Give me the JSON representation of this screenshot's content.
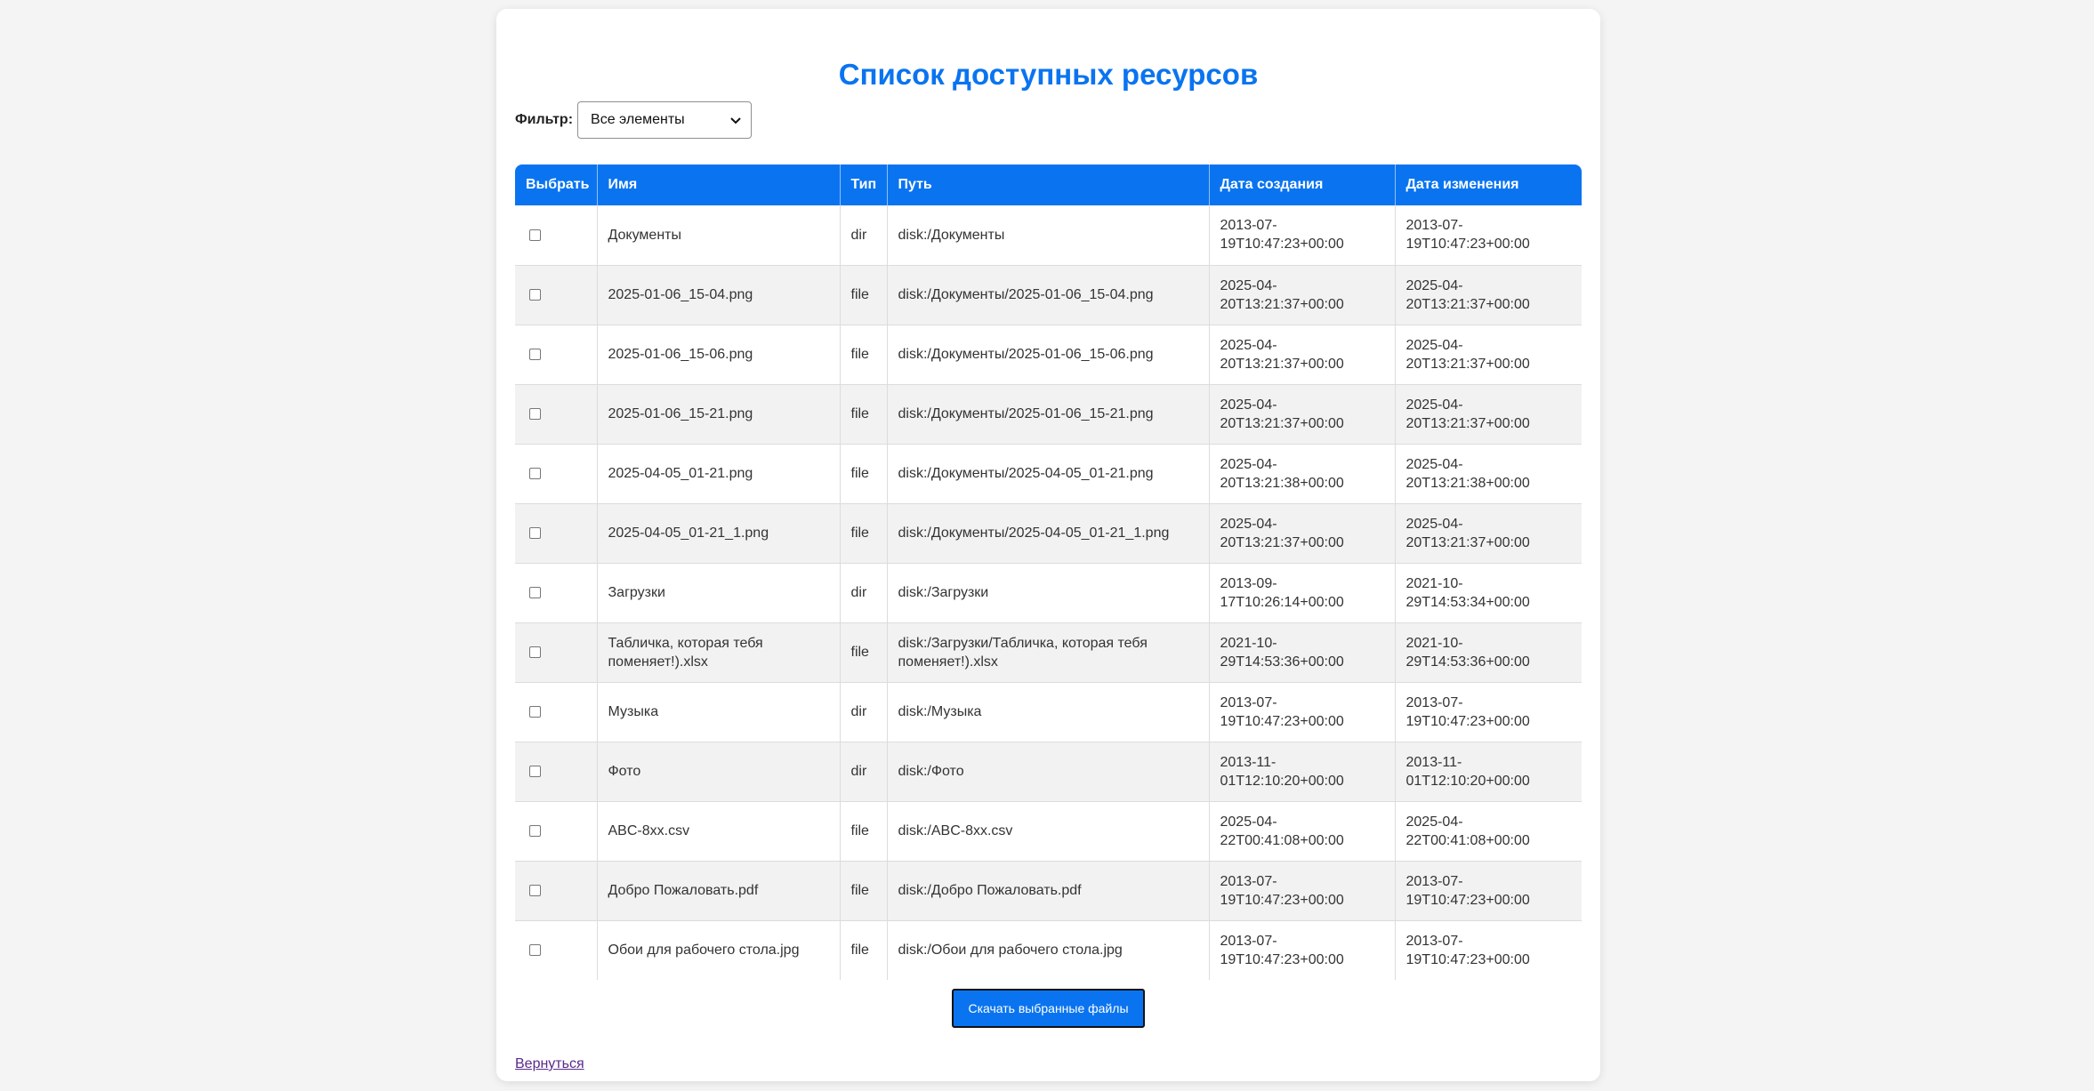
{
  "page": {
    "title": "Список доступных ресурсов"
  },
  "filter": {
    "label": "Фильтр:",
    "selected": "Все элементы"
  },
  "table": {
    "headers": [
      "Выбрать",
      "Имя",
      "Тип",
      "Путь",
      "Дата создания",
      "Дата изменения"
    ],
    "rows": [
      {
        "checked": false,
        "name": "Документы",
        "type": "dir",
        "path": "disk:/Документы",
        "created_a": "2013-07-",
        "created_b": "19T10:47:23+00:00",
        "modified_a": "2013-07-",
        "modified_b": "19T10:47:23+00:00"
      },
      {
        "checked": false,
        "name": "2025-01-06_15-04.png",
        "type": "file",
        "path": "disk:/Документы/2025-01-06_15-04.png",
        "created_a": "2025-04-",
        "created_b": "20T13:21:37+00:00",
        "modified_a": "2025-04-",
        "modified_b": "20T13:21:37+00:00"
      },
      {
        "checked": false,
        "name": "2025-01-06_15-06.png",
        "type": "file",
        "path": "disk:/Документы/2025-01-06_15-06.png",
        "created_a": "2025-04-",
        "created_b": "20T13:21:37+00:00",
        "modified_a": "2025-04-",
        "modified_b": "20T13:21:37+00:00"
      },
      {
        "checked": false,
        "name": "2025-01-06_15-21.png",
        "type": "file",
        "path": "disk:/Документы/2025-01-06_15-21.png",
        "created_a": "2025-04-",
        "created_b": "20T13:21:37+00:00",
        "modified_a": "2025-04-",
        "modified_b": "20T13:21:37+00:00"
      },
      {
        "checked": false,
        "name": "2025-04-05_01-21.png",
        "type": "file",
        "path": "disk:/Документы/2025-04-05_01-21.png",
        "created_a": "2025-04-",
        "created_b": "20T13:21:38+00:00",
        "modified_a": "2025-04-",
        "modified_b": "20T13:21:38+00:00"
      },
      {
        "checked": false,
        "name": "2025-04-05_01-21_1.png",
        "type": "file",
        "path": "disk:/Документы/2025-04-05_01-21_1.png",
        "created_a": "2025-04-",
        "created_b": "20T13:21:37+00:00",
        "modified_a": "2025-04-",
        "modified_b": "20T13:21:37+00:00"
      },
      {
        "checked": false,
        "name": "Загрузки",
        "type": "dir",
        "path": "disk:/Загрузки",
        "created_a": "2013-09-",
        "created_b": "17T10:26:14+00:00",
        "modified_a": "2021-10-",
        "modified_b": "29T14:53:34+00:00"
      },
      {
        "checked": false,
        "name": "Табличка, которая тебя поменяет!).xlsx",
        "type": "file",
        "path": "disk:/Загрузки/Табличка, которая тебя поменяет!).xlsx",
        "created_a": "2021-10-",
        "created_b": "29T14:53:36+00:00",
        "modified_a": "2021-10-",
        "modified_b": "29T14:53:36+00:00"
      },
      {
        "checked": false,
        "name": "Музыка",
        "type": "dir",
        "path": "disk:/Музыка",
        "created_a": "2013-07-",
        "created_b": "19T10:47:23+00:00",
        "modified_a": "2013-07-",
        "modified_b": "19T10:47:23+00:00"
      },
      {
        "checked": false,
        "name": "Фото",
        "type": "dir",
        "path": "disk:/Фото",
        "created_a": "2013-11-",
        "created_b": "01T12:10:20+00:00",
        "modified_a": "2013-11-",
        "modified_b": "01T12:10:20+00:00"
      },
      {
        "checked": false,
        "name": "ABC-8xx.csv",
        "type": "file",
        "path": "disk:/ABC-8xx.csv",
        "created_a": "2025-04-",
        "created_b": "22T00:41:08+00:00",
        "modified_a": "2025-04-",
        "modified_b": "22T00:41:08+00:00"
      },
      {
        "checked": false,
        "name": "Добро Пожаловать.pdf",
        "type": "file",
        "path": "disk:/Добро Пожаловать.pdf",
        "created_a": "2013-07-",
        "created_b": "19T10:47:23+00:00",
        "modified_a": "2013-07-",
        "modified_b": "19T10:47:23+00:00"
      },
      {
        "checked": false,
        "name": "Обои для рабочего стола.jpg",
        "type": "file",
        "path": "disk:/Обои для рабочего стола.jpg",
        "created_a": "2013-07-",
        "created_b": "19T10:47:23+00:00",
        "modified_a": "2013-07-",
        "modified_b": "19T10:47:23+00:00"
      }
    ]
  },
  "actions": {
    "download_label": "Скачать выбранные файлы",
    "back_label": "Вернуться"
  },
  "colors": {
    "accent": "#0a74f0",
    "background": "#f4f4f4",
    "card": "#ffffff",
    "row_alt": "#f2f2f2",
    "link": "#5a2a8a"
  }
}
